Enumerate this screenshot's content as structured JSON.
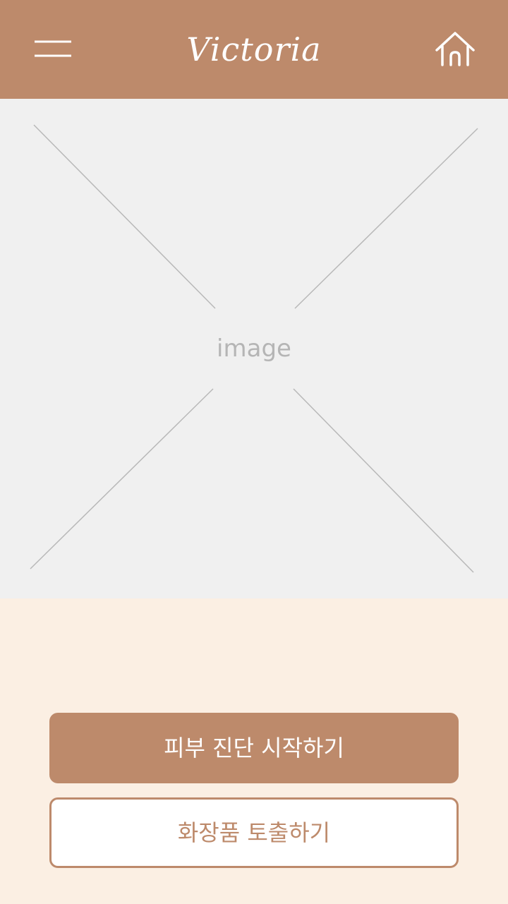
{
  "header": {
    "logo_text": "Victoria",
    "menu_icon": "hamburger-menu-icon",
    "home_icon": "home-icon"
  },
  "hero": {
    "placeholder_label": "image"
  },
  "actions": {
    "primary_label": "피부 진단 시작하기",
    "secondary_label": "화장품 토출하기"
  },
  "colors": {
    "brand": "#bd8a6b",
    "page_background": "#fbefe3",
    "placeholder_background": "#f0f0f0",
    "placeholder_text": "#b5b5b5"
  }
}
